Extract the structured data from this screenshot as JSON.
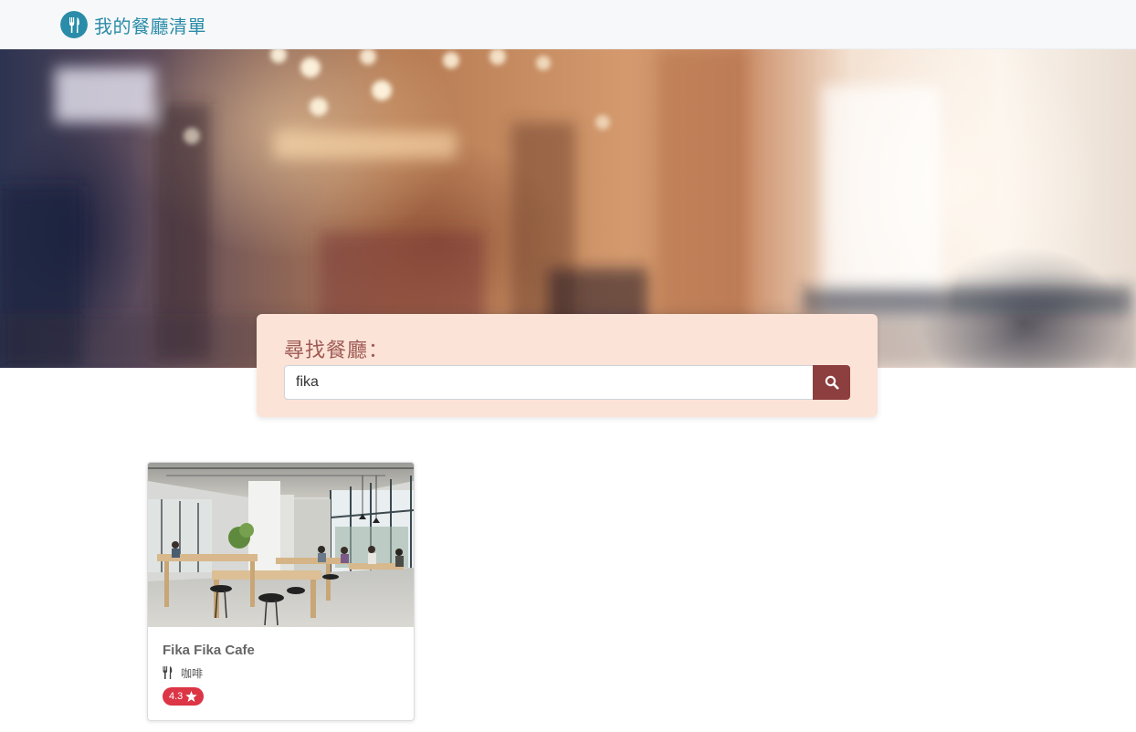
{
  "navbar": {
    "brand_icon": "fork-knife-icon",
    "brand_title": "我的餐廳清單"
  },
  "search": {
    "label": "尋找餐廳：",
    "value": "fika",
    "button_icon": "search-icon"
  },
  "restaurants": [
    {
      "name": "Fika Fika Cafe",
      "category_icon": "utensils-icon",
      "category": "咖啡",
      "rating": "4.3",
      "rating_icon": "star-icon"
    }
  ],
  "colors": {
    "brand": "#2a8ca8",
    "search_panel_bg": "#fce3d7",
    "search_label": "#9e5a54",
    "search_button": "#8d3e3f",
    "rating_badge": "#dc3545"
  }
}
